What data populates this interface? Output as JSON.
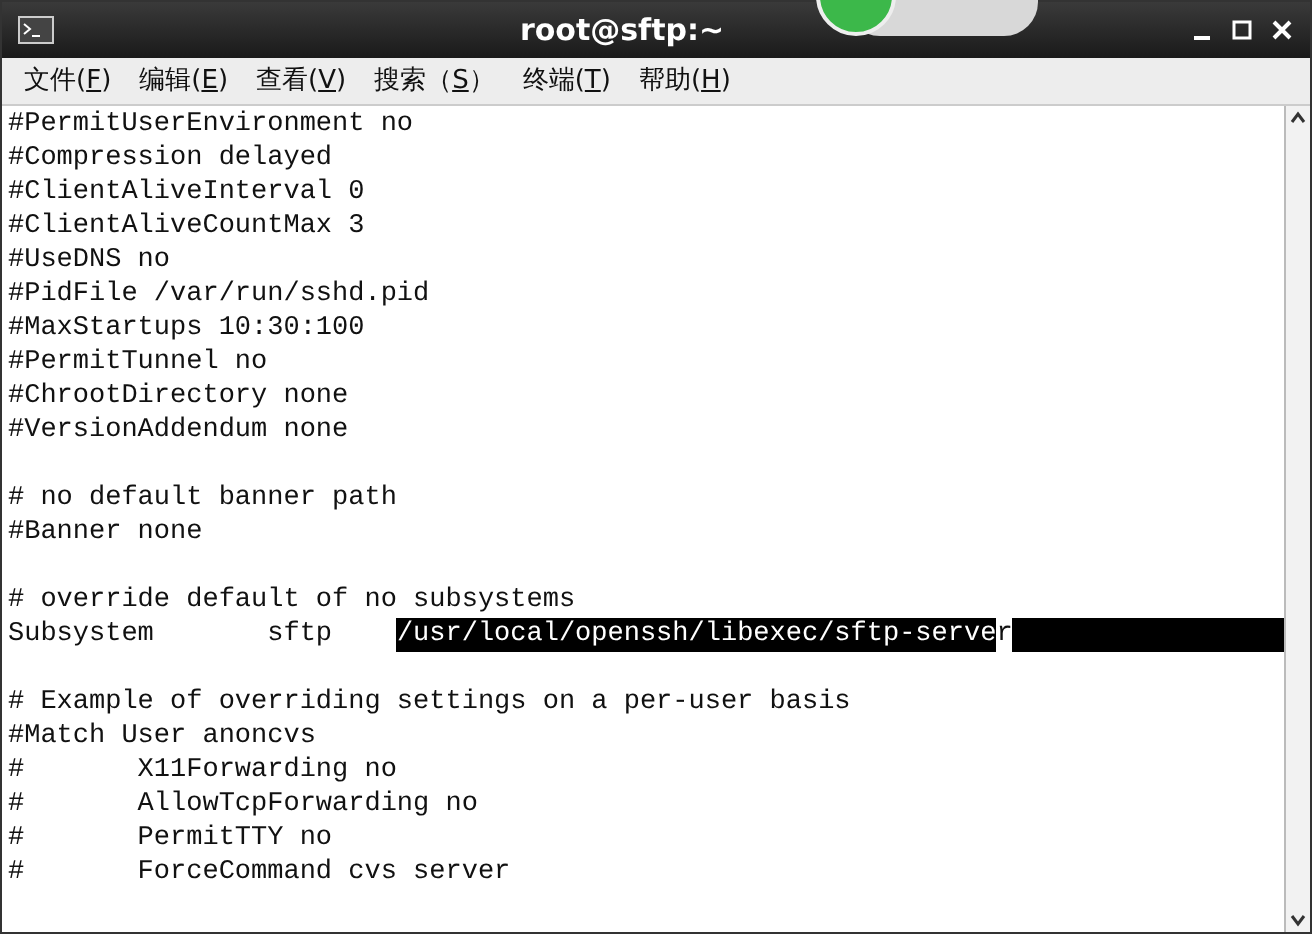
{
  "window": {
    "title": "root@sftp:~"
  },
  "menu": [
    {
      "label": "文件(",
      "key": "F",
      "end": ")"
    },
    {
      "label": "编辑(",
      "key": "E",
      "end": ")"
    },
    {
      "label": "查看(",
      "key": "V",
      "end": ")"
    },
    {
      "label": "搜索（",
      "key": "S",
      "end": "）"
    },
    {
      "label": "终端(",
      "key": "T",
      "end": ")"
    },
    {
      "label": "帮助(",
      "key": "H",
      "end": ")"
    }
  ],
  "blocks": [
    [
      {
        "text": "#PermitUserEnvironment no"
      },
      {
        "text": "#Compression delayed"
      },
      {
        "text": "#ClientAliveInterval 0"
      },
      {
        "text": "#ClientAliveCountMax 3"
      },
      {
        "text": "#UseDNS no"
      },
      {
        "text": "#PidFile /var/run/sshd.pid"
      },
      {
        "text": "#MaxStartups 10:30:100"
      },
      {
        "text": "#PermitTunnel no"
      },
      {
        "text": "#ChrootDirectory none"
      },
      {
        "text": "#VersionAddendum none"
      }
    ],
    [
      {
        "text": "# no default banner path"
      },
      {
        "text": "#Banner none"
      }
    ],
    [
      {
        "text": "# override default of no subsystems"
      },
      {
        "text": "Subsystem       sftp    ",
        "selected": "/usr/local/openssh/libexec/sftp-serve",
        "cursor": "r",
        "selected_to_end": true
      }
    ],
    [
      {
        "text": "# Example of overriding settings on a per-user basis"
      },
      {
        "text": "#Match User anoncvs"
      },
      {
        "text": "#       X11Forwarding no"
      },
      {
        "text": "#       AllowTcpForwarding no"
      },
      {
        "text": "#       PermitTTY no"
      },
      {
        "text": "#       ForceCommand cvs server"
      }
    ]
  ]
}
